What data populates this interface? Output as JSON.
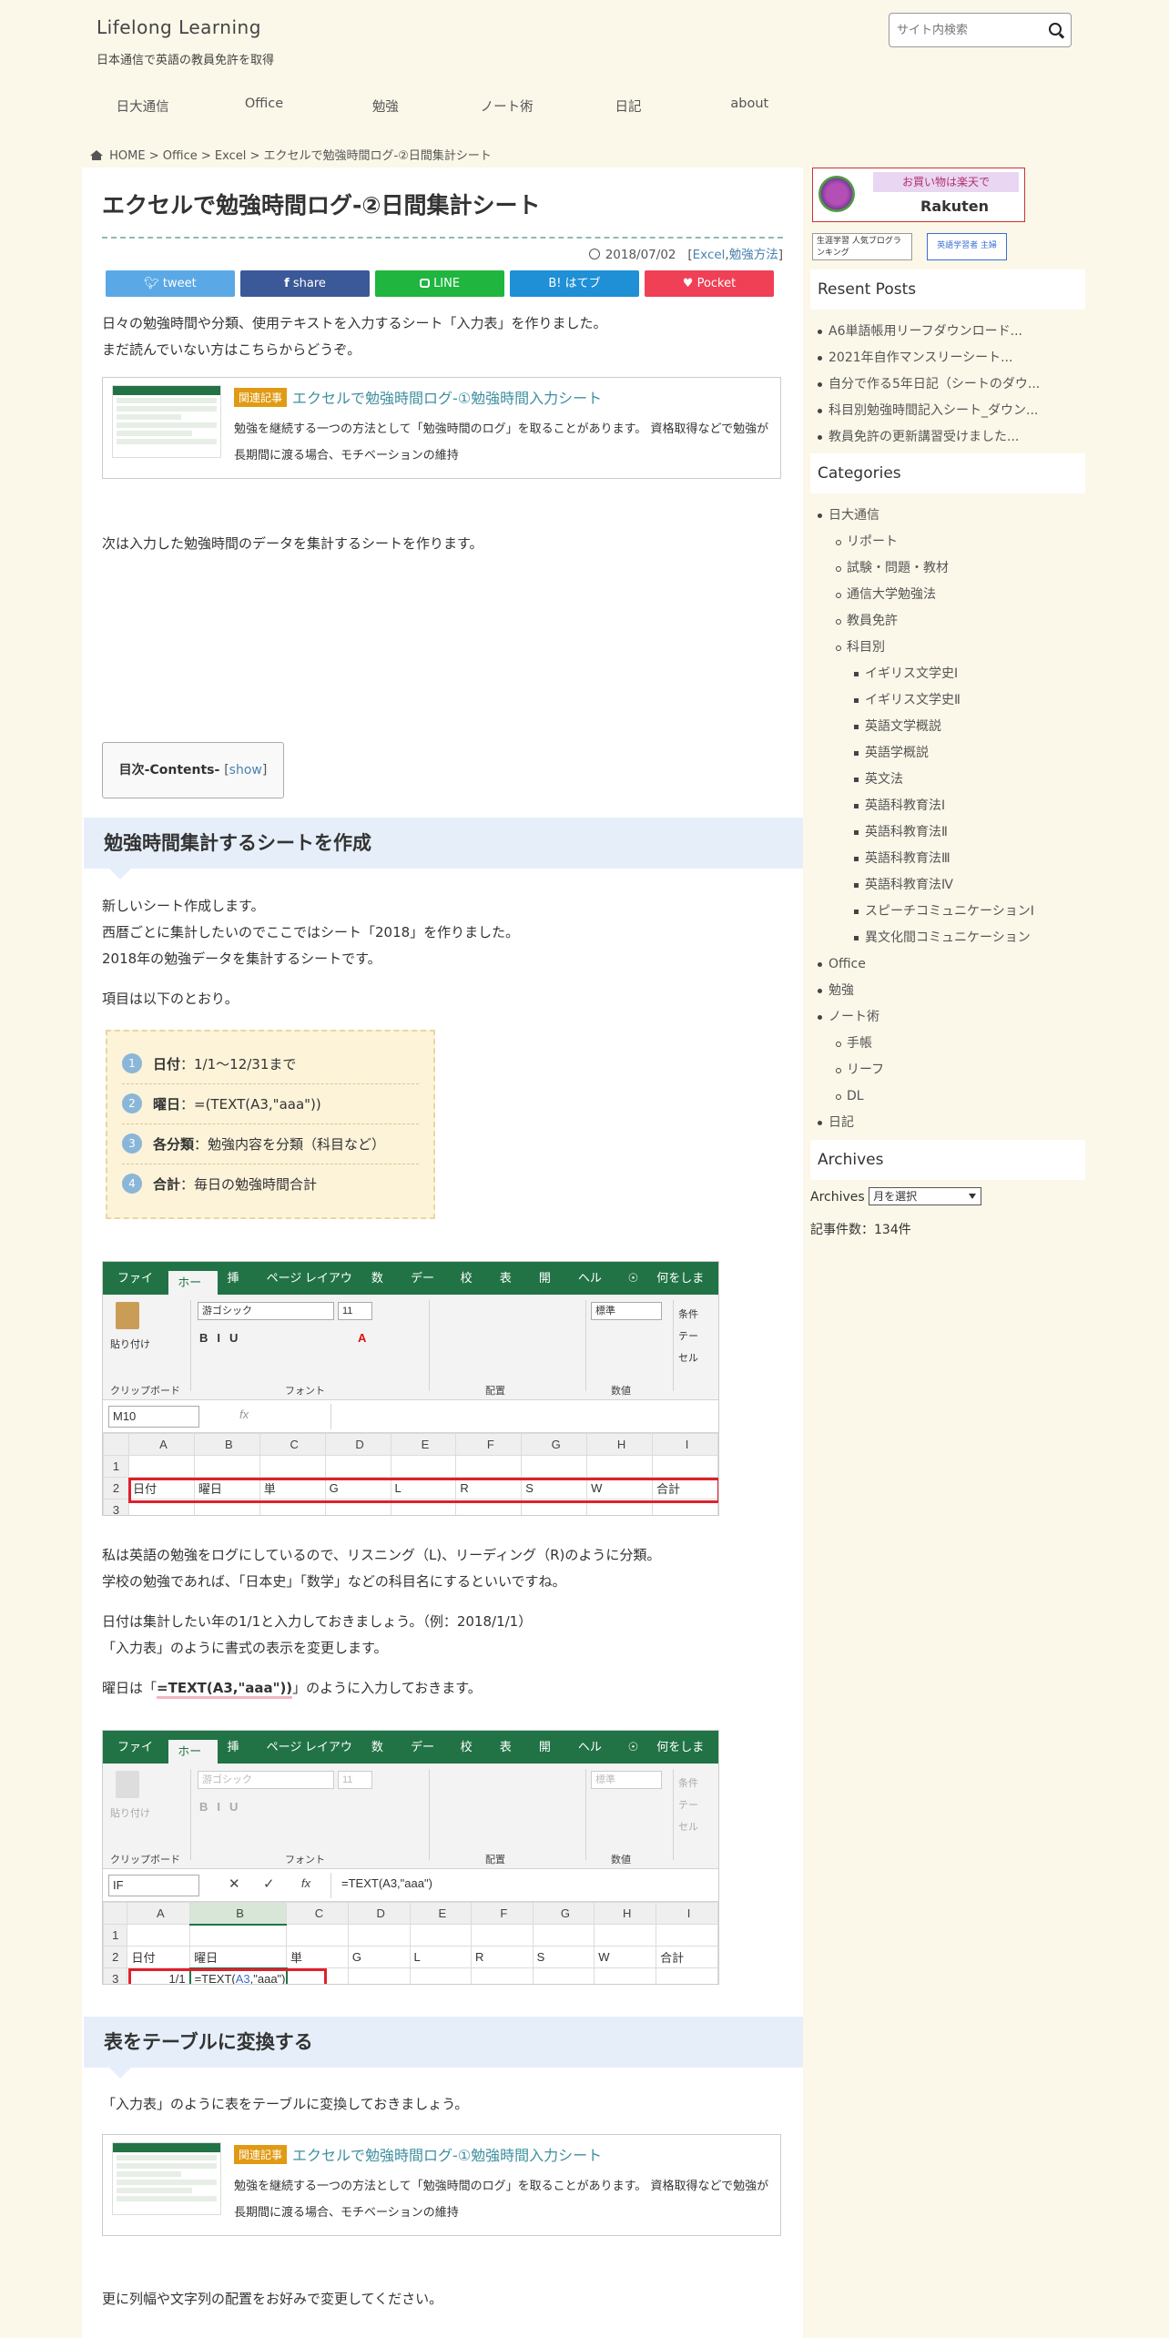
{
  "header": {
    "site_title": "Lifelong Learning",
    "site_desc": "日本通信で英語の教員免許を取得",
    "search_placeholder": "サイト内検索"
  },
  "nav": [
    "日大通信",
    "Office",
    "勉強",
    "ノート術",
    "日記",
    "about"
  ],
  "breadcrumb": {
    "home": "HOME",
    "sep": ">",
    "items": [
      "Office",
      "Excel",
      "エクセルで勉強時間ログ-②日間集計シート"
    ]
  },
  "post": {
    "title": "エクセルで勉強時間ログ-②日間集計シート",
    "date": "2018/07/02",
    "cat_open": "[",
    "categories": [
      "Excel",
      "勉強方法"
    ],
    "cat_close": "]",
    "share": [
      {
        "label": "tweet",
        "color": "#5aa9e6"
      },
      {
        "label": "share",
        "color": "#3b5998"
      },
      {
        "label": "LINE",
        "color": "#1fb53f"
      },
      {
        "label": "B! はてブ",
        "color": "#1f8fd6"
      },
      {
        "label": "Pocket",
        "color": "#ef4056"
      }
    ],
    "intro1": "日々の勉強時間や分類、使用テキストを入力するシート「入力表」を作りました。",
    "intro2": "まだ読んでいない方はこちらからどうぞ。",
    "related": {
      "tag": "関連記事",
      "title": "エクセルで勉強時間ログ-①勉強時間入力シート",
      "desc": "勉強を継続する一つの方法として「勉強時間のログ」を取ることがあります。 資格取得などで勉強が長期間に渡る場合、モチベーションの維持"
    },
    "p_next": "次は入力した勉強時間のデータを集計するシートを作ります。",
    "toc": {
      "label": "目次-Contents-",
      "open": "[",
      "toggle": "show",
      "close": "]"
    },
    "h2_1": "勉強時間集計するシートを作成",
    "s1_l1": "新しいシート作成します。",
    "s1_l2": "西暦ごとに集計したいのでここではシート「2018」を作りました。",
    "s1_l3": "2018年の勉強データを集計するシートです。",
    "s1_l4": "項目は以下のとおり。",
    "items": [
      {
        "num": "1",
        "label": "日付",
        "text": "：1/1～12/31まで"
      },
      {
        "num": "2",
        "label": "曜日",
        "text": "：=(TEXT(A3,\"aaa\"))"
      },
      {
        "num": "3",
        "label": "各分類",
        "text": "：勉強内容を分類（科目など）"
      },
      {
        "num": "4",
        "label": "合計",
        "text": "：毎日の勉強時間合計"
      }
    ],
    "s2_l1": "私は英語の勉強をログにしているので、リスニング（L)、リーディング（R)のように分類。",
    "s2_l2": "学校の勉強であれば、「日本史」「数学」などの科目名にするといいですね。",
    "s2_l3": "日付は集計したい年の1/1と入力しておきましょう。（例：2018/1/1）",
    "s2_l4": "「入力表」のように書式の表示を変更します。",
    "s2_l5a": "曜日は「",
    "s2_l5b": "=TEXT(A3,\"aaa\"))",
    "s2_l5c": "」のように入力しておきます。",
    "h2_2": "表をテーブルに変換する",
    "s3_l1": "「入力表」のように表をテーブルに変換しておきましょう。",
    "s3_l2": "更に列幅や文字列の配置をお好みで変更してください。"
  },
  "excel": {
    "tabs": [
      "ファイル",
      "ホーム",
      "挿入",
      "ページ レイアウト",
      "数式",
      "データ",
      "校閲",
      "表示",
      "開発",
      "ヘルプ",
      "何をします"
    ],
    "clip": "クリップボード",
    "paste": "貼り付け",
    "font_group": "フォント",
    "align_group": "配置",
    "num_group": "数値",
    "font_name": "游ゴシック",
    "font_size": "11",
    "num_fmt": "標準",
    "styles": [
      "条件",
      "テー",
      "セル"
    ],
    "name1": "M10",
    "name2": "IF",
    "fx": "fx",
    "formula2": "=TEXT(A3,\"aaa\")",
    "cols": [
      "A",
      "B",
      "C",
      "D",
      "E",
      "F",
      "G",
      "H",
      "I"
    ],
    "rows": [
      "1",
      "2",
      "3"
    ],
    "headers": [
      "日付",
      "曜日",
      "単",
      "G",
      "L",
      "R",
      "S",
      "W",
      "合計"
    ],
    "a3": "1/1",
    "b3_pre": "=TEXT(",
    "b3_ref": "A3",
    "b3_post": ",\"aaa\")"
  },
  "sidebar": {
    "ad1_l1": "お買い物は楽天で",
    "ad1_l2": "Rakuten",
    "ad2": "生涯学習 人気ブログランキング",
    "ad3": "英語学習者 主婦",
    "recent_title": "Resent Posts",
    "recent": [
      "A6単語帳用リーフダウンロード...",
      "2021年自作マンスリーシート...",
      "自分で作る5年日記（シートのダウ...",
      "科目別勉強時間記入シート_ダウン...",
      "教員免許の更新講習受けました..."
    ],
    "cat_title": "Categories",
    "cats": [
      {
        "t": "日大通信",
        "lv": 0
      },
      {
        "t": "リポート",
        "lv": 1
      },
      {
        "t": "試験・問題・教材",
        "lv": 1
      },
      {
        "t": "通信大学勉強法",
        "lv": 1
      },
      {
        "t": "教員免許",
        "lv": 1
      },
      {
        "t": "科目別",
        "lv": 1
      },
      {
        "t": "イギリス文学史Ⅰ",
        "lv": 2
      },
      {
        "t": "イギリス文学史Ⅱ",
        "lv": 2
      },
      {
        "t": "英語文学概説",
        "lv": 2
      },
      {
        "t": "英語学概説",
        "lv": 2
      },
      {
        "t": "英文法",
        "lv": 2
      },
      {
        "t": "英語科教育法Ⅰ",
        "lv": 2
      },
      {
        "t": "英語科教育法Ⅱ",
        "lv": 2
      },
      {
        "t": "英語科教育法Ⅲ",
        "lv": 2
      },
      {
        "t": "英語科教育法Ⅳ",
        "lv": 2
      },
      {
        "t": "スピーチコミュニケーションⅠ",
        "lv": 2
      },
      {
        "t": "異文化間コミュニケーション",
        "lv": 2
      },
      {
        "t": "Office",
        "lv": 0
      },
      {
        "t": "勉強",
        "lv": 0
      },
      {
        "t": "ノート術",
        "lv": 0
      },
      {
        "t": "手帳",
        "lv": 1
      },
      {
        "t": "リーフ",
        "lv": 1
      },
      {
        "t": "DL",
        "lv": 1
      },
      {
        "t": "日記",
        "lv": 0
      }
    ],
    "arch_title": "Archives",
    "arch_label": "Archives",
    "arch_select": "月を選択",
    "count": "記事件数：134件"
  }
}
